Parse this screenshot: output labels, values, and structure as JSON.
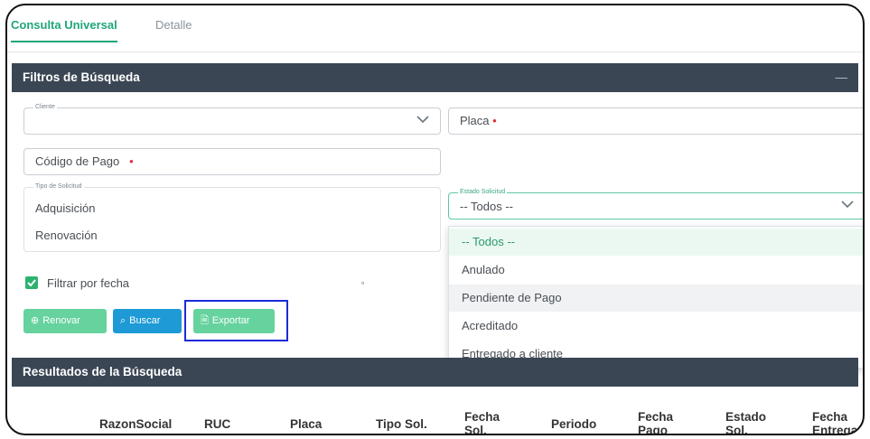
{
  "tabs": {
    "active": "Consulta Universal",
    "inactive": "Detalle"
  },
  "filters": {
    "header": "Filtros de Búsqueda",
    "collapse_glyph": "—",
    "cliente_legend": "Cliente",
    "cliente_value": "",
    "placa_label": "Placa",
    "required_mark": "•",
    "codigo_label": "Código de Pago",
    "tipo_legend": "Tipo de Solicitud",
    "tipo_options": [
      "Adquisición",
      "Renovación"
    ],
    "estado_legend": "Estado Solicitud",
    "estado_value": "-- Todos --",
    "estado_options": [
      "-- Todos --",
      "Anulado",
      "Pendiente de Pago",
      "Acreditado",
      "Entregado a cliente"
    ],
    "estado_selected_index": 0,
    "estado_hover_index": 2,
    "filtrar_fecha_label": "Filtrar por fecha",
    "filtrar_fecha_checked": true,
    "stray_mark": "▫"
  },
  "actions": {
    "renovar": "Renovar",
    "buscar": "Buscar",
    "exportar": "Exportar"
  },
  "results": {
    "header": "Resultados de la Búsqueda",
    "columns": [
      "RazonSocial",
      "RUC",
      "Placa",
      "Tipo Sol.",
      "Fecha\nSol.",
      "Periodo",
      "Fecha\nPago",
      "Estado\nSol.",
      "Fecha\nEntrega"
    ]
  },
  "colors": {
    "accent": "#1fa67a",
    "header_bg": "#3a4654",
    "btn_green": "#66d39e",
    "btn_blue": "#1e9ad6",
    "highlight": "#1c2bd8",
    "required": "#e0303b"
  }
}
